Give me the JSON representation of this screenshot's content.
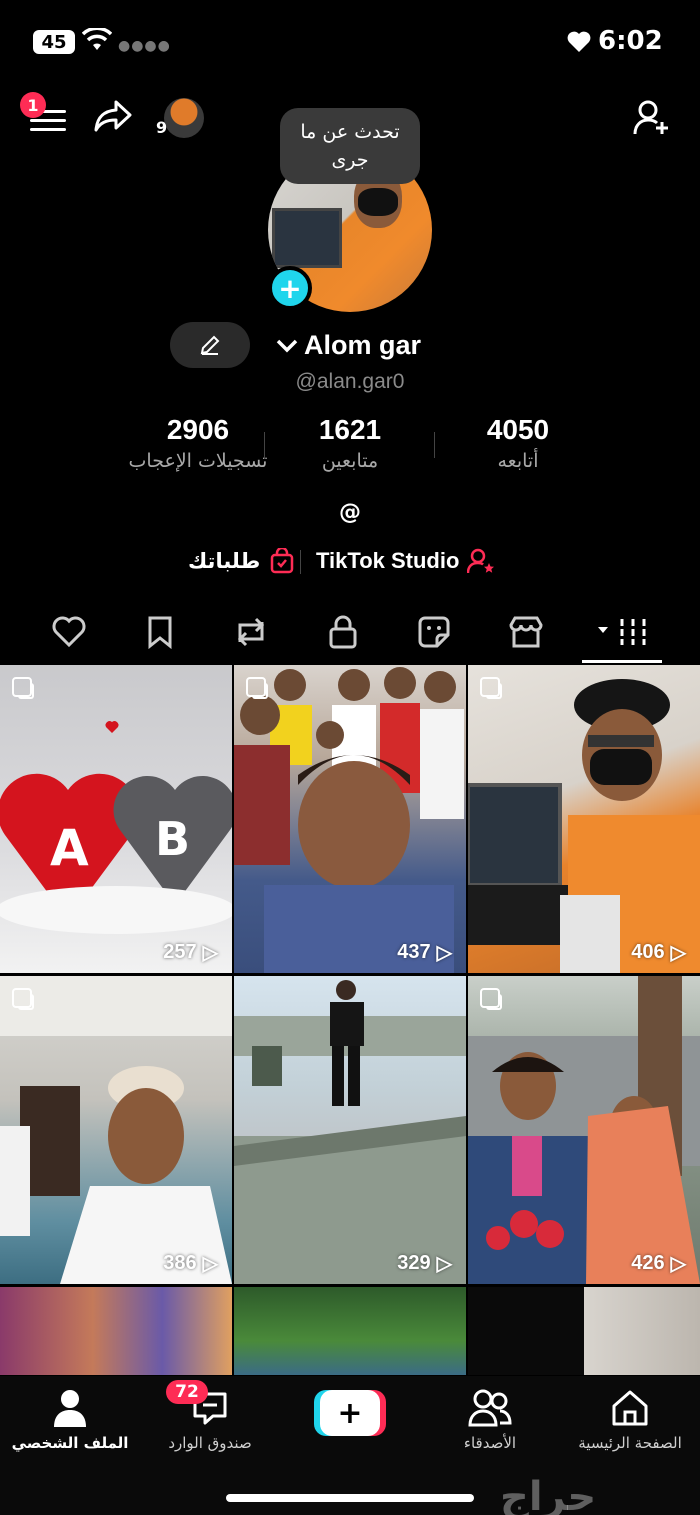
{
  "status_bar": {
    "time": "6:02",
    "battery": "45"
  },
  "top_bar": {
    "menu_badge": "1",
    "mini_avatar_count": "9"
  },
  "profile": {
    "bubble_text": "تحدث عن ما جرى",
    "name": "Alom gar",
    "handle": "@alan.gar0",
    "stats": [
      {
        "value": "4050",
        "label": "أتابعه"
      },
      {
        "value": "1621",
        "label": "متابعين"
      },
      {
        "value": "2906",
        "label": "تسجيلات الإعجاب"
      }
    ],
    "at_symbol": "@",
    "studio_label": "TikTok Studio",
    "orders_label": "طلباتك"
  },
  "tabs": [
    "videos-grid",
    "shop",
    "favorites-sticker",
    "private",
    "reposts",
    "bookmarks",
    "liked"
  ],
  "videos": [
    {
      "views": "257"
    },
    {
      "views": "437"
    },
    {
      "views": "406"
    },
    {
      "views": "386"
    },
    {
      "views": "329"
    },
    {
      "views": "426"
    }
  ],
  "bottom_nav": {
    "home": "الصفحة الرئيسية",
    "friends": "الأصدقاء",
    "inbox": "صندوق الوارد",
    "inbox_badge": "72",
    "profile": "الملف الشخصي",
    "create": "+"
  },
  "watermark": "حراج",
  "colors": {
    "accent_red": "#fe2c55",
    "accent_cyan": "#20d5ec"
  }
}
